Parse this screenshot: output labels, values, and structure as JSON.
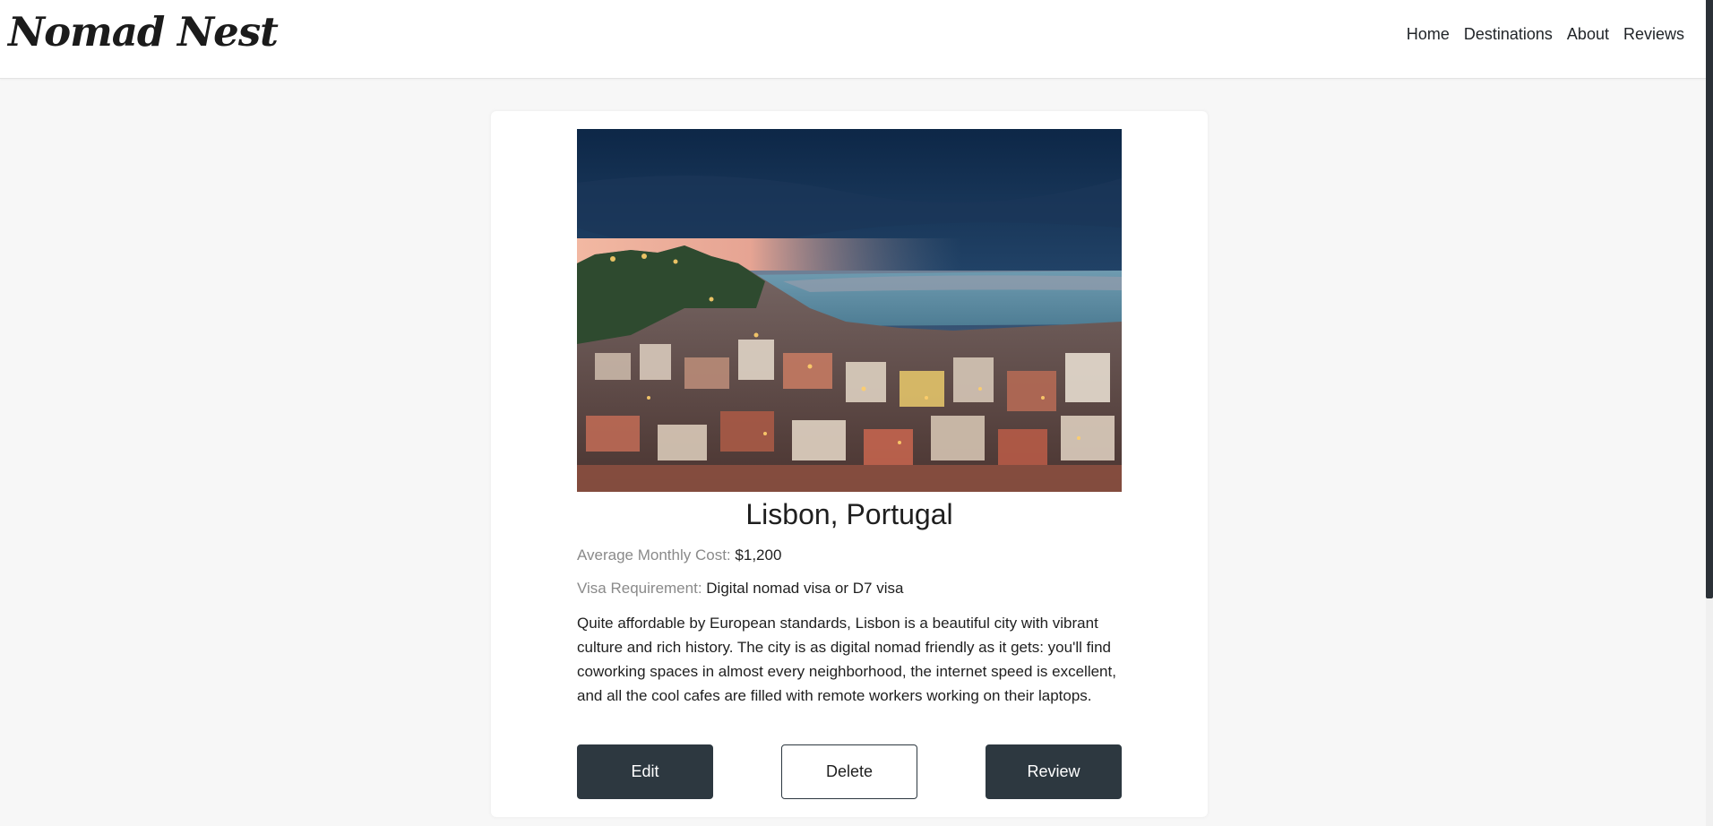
{
  "brand": {
    "name": "Nomad Nest"
  },
  "nav": {
    "items": [
      {
        "label": "Home"
      },
      {
        "label": "Destinations"
      },
      {
        "label": "About"
      },
      {
        "label": "Reviews"
      }
    ]
  },
  "destination": {
    "title": "Lisbon, Portugal",
    "cost_label": "Average Monthly Cost:",
    "cost_value": "$1,200",
    "visa_label": "Visa Requirement:",
    "visa_value": "Digital nomad visa or D7 visa",
    "description": "Quite affordable by European standards, Lisbon is a beautiful city with vibrant culture and rich history. The city is as digital nomad friendly as it gets: you'll find coworking spaces in almost every neighborhood, the internet speed is excellent, and all the cool cafes are filled with remote workers working on their laptops."
  },
  "actions": {
    "edit_label": "Edit",
    "delete_label": "Delete",
    "review_label": "Review"
  },
  "colors": {
    "button_dark": "#2d3840",
    "page_bg": "#f7f7f7",
    "label_gray": "#8a8a8a"
  }
}
